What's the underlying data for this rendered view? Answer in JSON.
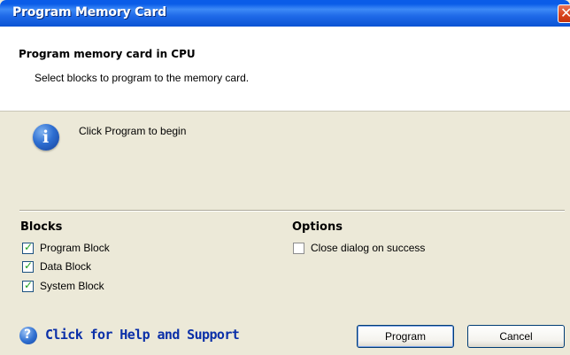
{
  "window": {
    "title": "Program Memory Card",
    "close_glyph": "✕"
  },
  "header": {
    "title": "Program memory card in CPU",
    "subtitle": "Select blocks to program to the memory card."
  },
  "info": {
    "icon": "info-icon",
    "message": "Click Program to begin"
  },
  "blocks": {
    "heading": "Blocks",
    "items": [
      {
        "label": "Program Block",
        "checked": true
      },
      {
        "label": "Data Block",
        "checked": true
      },
      {
        "label": "System Block",
        "checked": true
      }
    ]
  },
  "options": {
    "heading": "Options",
    "items": [
      {
        "label": "Close dialog on success",
        "checked": false
      }
    ]
  },
  "footer": {
    "help_icon": "help-icon",
    "help_label": "Click for Help and Support",
    "program_label": "Program",
    "cancel_label": "Cancel"
  },
  "colors": {
    "titlebar": "#0a5ce8",
    "dialog_bg": "#ece9d8",
    "link": "#0a2fa8",
    "check_mark": "#21a121"
  }
}
